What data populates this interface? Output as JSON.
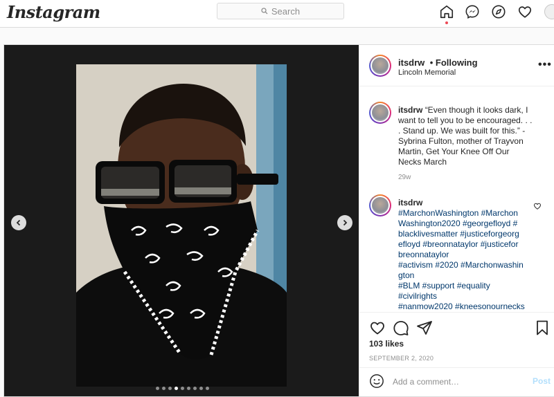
{
  "header": {
    "logo": "Instagram",
    "search_placeholder": "Search",
    "icons": [
      "home-icon",
      "messenger-icon",
      "explore-icon",
      "activity-heart-icon",
      "profile-avatar"
    ]
  },
  "post": {
    "author": "itsdrw",
    "follow_status": "• Following",
    "location": "Lincoln Memorial",
    "caption_author": "itsdrw",
    "caption": "“Even though it looks dark, I want to tell you to be encouraged. . . . Stand up. We was built for this.” - Sybrina Fulton, mother of Trayvon Martin, Get Your Knee Off Our Necks March",
    "caption_age": "29w",
    "comment": {
      "author": "itsdrw",
      "lines": [
        "#MarchonWashington #Marchon",
        "Washington2020 #georgefloyd #",
        "blacklivesmatter  #justiceforgeorg",
        "efloyd #breonnataylor #justicefor",
        "breonnataylor",
        "#activism #2020 #Marchonwashin",
        "gton",
        "#BLM #support #equality",
        "#civilrights",
        "#nanmow2020 #kneesonournecks"
      ]
    },
    "likes": "103 likes",
    "date": "SEPTEMBER 2, 2020",
    "comment_placeholder": "Add a comment…",
    "post_button": "Post",
    "carousel": {
      "count": 9,
      "active_index": 3
    }
  },
  "colors": {
    "accent_link": "#00376b",
    "post_button": "#b2dffc",
    "notification_dot": "#ed4956"
  }
}
